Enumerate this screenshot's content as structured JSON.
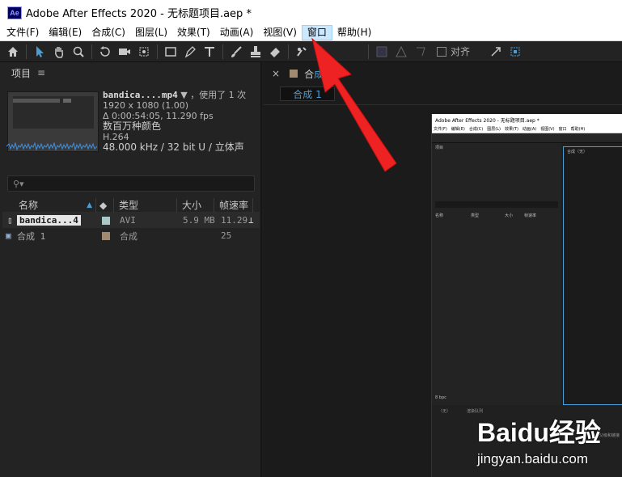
{
  "window": {
    "title": "Adobe After Effects 2020 - 无标题项目.aep *",
    "app_icon": "Ae"
  },
  "menu": {
    "items": [
      {
        "label": "文件(F)"
      },
      {
        "label": "编辑(E)"
      },
      {
        "label": "合成(C)"
      },
      {
        "label": "图层(L)"
      },
      {
        "label": "效果(T)"
      },
      {
        "label": "动画(A)"
      },
      {
        "label": "视图(V)"
      },
      {
        "label": "窗口"
      },
      {
        "label": "帮助(H)"
      }
    ],
    "active_index": 7
  },
  "toolbar": {
    "tools": [
      "home-icon",
      "selection-arrow-icon",
      "hand-icon",
      "zoom-icon",
      "rotate-icon",
      "camera-icon",
      "pan-behind-icon",
      "rectangle-icon",
      "pen-icon",
      "text-icon",
      "brush-icon",
      "clone-stamp-icon",
      "eraser-icon",
      "roto-brush-icon",
      "puppet-pin-icon"
    ],
    "snap_label": "对齐"
  },
  "project": {
    "title": "项目",
    "file": {
      "name": "bandica....mp4",
      "used": "，使用了 1 次",
      "resolution": "1920 x 1080 (1.00)",
      "duration": "Δ 0:00:54:05, 11.290 fps",
      "colors": "数百万种颜色",
      "codec": "H.264",
      "audio": "48.000 kHz / 32 bit U / 立体声"
    },
    "search_placeholder": "",
    "columns": {
      "name": "名称",
      "type": "类型",
      "size": "大小",
      "fps": "帧速率"
    },
    "rows": [
      {
        "name": "bandica...4",
        "type": "AVI",
        "size": "5.9 MB",
        "fps": "11.29",
        "swatch": "#a9c9c9"
      },
      {
        "name": "合成 1",
        "type": "合成",
        "size": "",
        "fps": "25",
        "swatch": "#a08a70"
      }
    ]
  },
  "composition": {
    "tab_prefix": "合",
    "tab_name": "成 1",
    "subtab": "合成 1"
  },
  "inner_screenshot": {
    "title": "Adobe After Effects 2020 - 无标题项目.aep *",
    "menu": [
      "文件(F)",
      "编辑(E)",
      "合成(C)",
      "图层(L)",
      "效果(T)",
      "动画(A)",
      "视图(V)",
      "窗口",
      "帮助(H)"
    ],
    "project_label": "项目",
    "col_name": "名称",
    "col_type": "类型",
    "col_size": "大小",
    "col_fps": "帧速率",
    "comp_label": "合成（无）",
    "bottom_tab1": "（无）",
    "bottom_tab2": "渲染队列",
    "bottom_right": "父级和链接",
    "bpc": "8 bpc"
  },
  "watermark": {
    "logo": "Baidu经验",
    "url": "jingyan.baidu.com"
  }
}
